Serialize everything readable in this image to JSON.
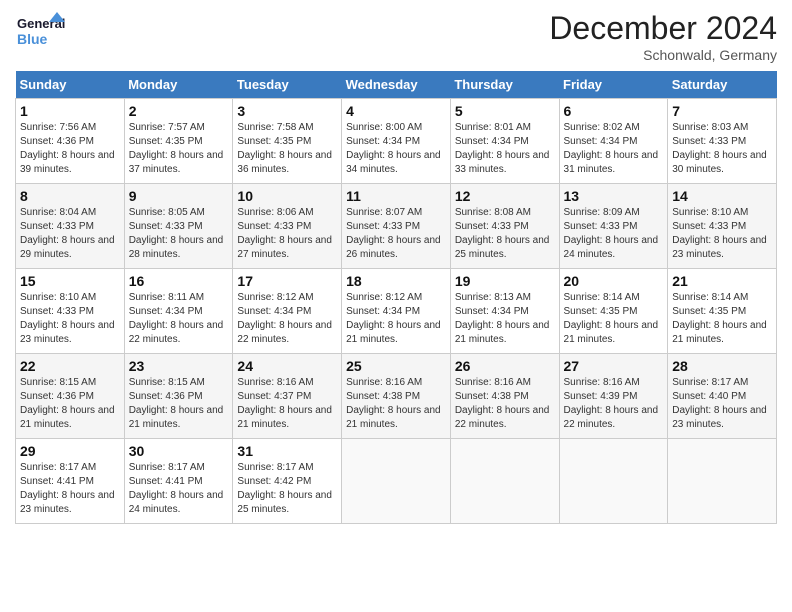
{
  "header": {
    "logo_line1": "General",
    "logo_line2": "Blue",
    "month": "December 2024",
    "location": "Schonwald, Germany"
  },
  "days_of_week": [
    "Sunday",
    "Monday",
    "Tuesday",
    "Wednesday",
    "Thursday",
    "Friday",
    "Saturday"
  ],
  "weeks": [
    [
      {
        "day": 1,
        "sunrise": "7:56 AM",
        "sunset": "4:36 PM",
        "daylight": "8 hours and 39 minutes."
      },
      {
        "day": 2,
        "sunrise": "7:57 AM",
        "sunset": "4:35 PM",
        "daylight": "8 hours and 37 minutes."
      },
      {
        "day": 3,
        "sunrise": "7:58 AM",
        "sunset": "4:35 PM",
        "daylight": "8 hours and 36 minutes."
      },
      {
        "day": 4,
        "sunrise": "8:00 AM",
        "sunset": "4:34 PM",
        "daylight": "8 hours and 34 minutes."
      },
      {
        "day": 5,
        "sunrise": "8:01 AM",
        "sunset": "4:34 PM",
        "daylight": "8 hours and 33 minutes."
      },
      {
        "day": 6,
        "sunrise": "8:02 AM",
        "sunset": "4:34 PM",
        "daylight": "8 hours and 31 minutes."
      },
      {
        "day": 7,
        "sunrise": "8:03 AM",
        "sunset": "4:33 PM",
        "daylight": "8 hours and 30 minutes."
      }
    ],
    [
      {
        "day": 8,
        "sunrise": "8:04 AM",
        "sunset": "4:33 PM",
        "daylight": "8 hours and 29 minutes."
      },
      {
        "day": 9,
        "sunrise": "8:05 AM",
        "sunset": "4:33 PM",
        "daylight": "8 hours and 28 minutes."
      },
      {
        "day": 10,
        "sunrise": "8:06 AM",
        "sunset": "4:33 PM",
        "daylight": "8 hours and 27 minutes."
      },
      {
        "day": 11,
        "sunrise": "8:07 AM",
        "sunset": "4:33 PM",
        "daylight": "8 hours and 26 minutes."
      },
      {
        "day": 12,
        "sunrise": "8:08 AM",
        "sunset": "4:33 PM",
        "daylight": "8 hours and 25 minutes."
      },
      {
        "day": 13,
        "sunrise": "8:09 AM",
        "sunset": "4:33 PM",
        "daylight": "8 hours and 24 minutes."
      },
      {
        "day": 14,
        "sunrise": "8:10 AM",
        "sunset": "4:33 PM",
        "daylight": "8 hours and 23 minutes."
      }
    ],
    [
      {
        "day": 15,
        "sunrise": "8:10 AM",
        "sunset": "4:33 PM",
        "daylight": "8 hours and 23 minutes."
      },
      {
        "day": 16,
        "sunrise": "8:11 AM",
        "sunset": "4:34 PM",
        "daylight": "8 hours and 22 minutes."
      },
      {
        "day": 17,
        "sunrise": "8:12 AM",
        "sunset": "4:34 PM",
        "daylight": "8 hours and 22 minutes."
      },
      {
        "day": 18,
        "sunrise": "8:12 AM",
        "sunset": "4:34 PM",
        "daylight": "8 hours and 21 minutes."
      },
      {
        "day": 19,
        "sunrise": "8:13 AM",
        "sunset": "4:34 PM",
        "daylight": "8 hours and 21 minutes."
      },
      {
        "day": 20,
        "sunrise": "8:14 AM",
        "sunset": "4:35 PM",
        "daylight": "8 hours and 21 minutes."
      },
      {
        "day": 21,
        "sunrise": "8:14 AM",
        "sunset": "4:35 PM",
        "daylight": "8 hours and 21 minutes."
      }
    ],
    [
      {
        "day": 22,
        "sunrise": "8:15 AM",
        "sunset": "4:36 PM",
        "daylight": "8 hours and 21 minutes."
      },
      {
        "day": 23,
        "sunrise": "8:15 AM",
        "sunset": "4:36 PM",
        "daylight": "8 hours and 21 minutes."
      },
      {
        "day": 24,
        "sunrise": "8:16 AM",
        "sunset": "4:37 PM",
        "daylight": "8 hours and 21 minutes."
      },
      {
        "day": 25,
        "sunrise": "8:16 AM",
        "sunset": "4:38 PM",
        "daylight": "8 hours and 21 minutes."
      },
      {
        "day": 26,
        "sunrise": "8:16 AM",
        "sunset": "4:38 PM",
        "daylight": "8 hours and 22 minutes."
      },
      {
        "day": 27,
        "sunrise": "8:16 AM",
        "sunset": "4:39 PM",
        "daylight": "8 hours and 22 minutes."
      },
      {
        "day": 28,
        "sunrise": "8:17 AM",
        "sunset": "4:40 PM",
        "daylight": "8 hours and 23 minutes."
      }
    ],
    [
      {
        "day": 29,
        "sunrise": "8:17 AM",
        "sunset": "4:41 PM",
        "daylight": "8 hours and 23 minutes."
      },
      {
        "day": 30,
        "sunrise": "8:17 AM",
        "sunset": "4:41 PM",
        "daylight": "8 hours and 24 minutes."
      },
      {
        "day": 31,
        "sunrise": "8:17 AM",
        "sunset": "4:42 PM",
        "daylight": "8 hours and 25 minutes."
      },
      null,
      null,
      null,
      null
    ]
  ]
}
